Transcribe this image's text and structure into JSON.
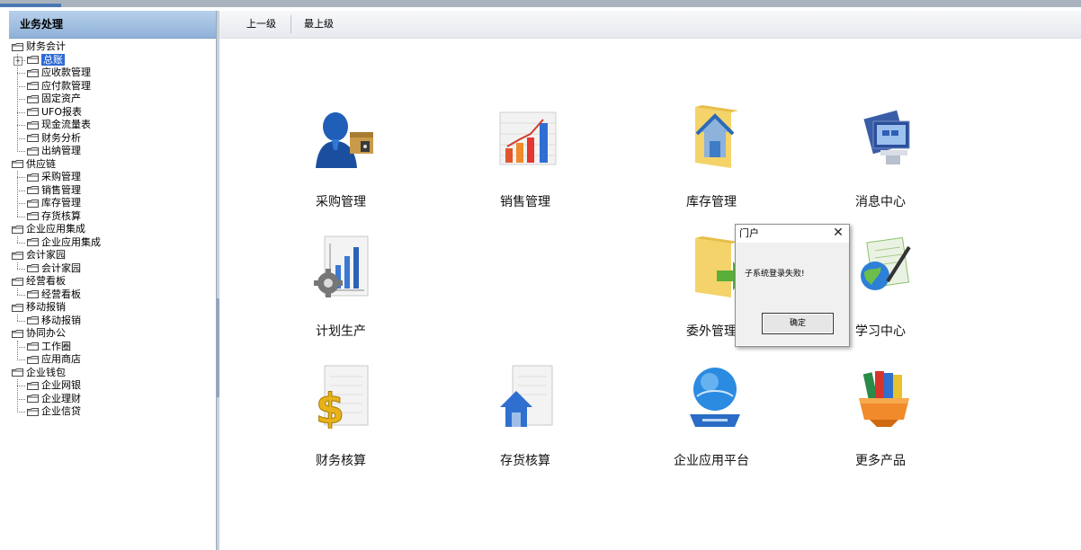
{
  "left_panel": {
    "header": "业务处理",
    "tree": [
      {
        "label": "财务会计",
        "level": 0,
        "expanded": true
      },
      {
        "label": "总账",
        "level": 1,
        "selected": true,
        "collapsed": true
      },
      {
        "label": "应收款管理",
        "level": 1
      },
      {
        "label": "应付款管理",
        "level": 1
      },
      {
        "label": "固定资产",
        "level": 1
      },
      {
        "label": "UFO报表",
        "level": 1
      },
      {
        "label": "现金流量表",
        "level": 1
      },
      {
        "label": "财务分析",
        "level": 1
      },
      {
        "label": "出纳管理",
        "level": 1
      },
      {
        "label": "供应链",
        "level": 0,
        "expanded": true
      },
      {
        "label": "采购管理",
        "level": 1
      },
      {
        "label": "销售管理",
        "level": 1
      },
      {
        "label": "库存管理",
        "level": 1
      },
      {
        "label": "存货核算",
        "level": 1
      },
      {
        "label": "企业应用集成",
        "level": 0,
        "expanded": true
      },
      {
        "label": "企业应用集成",
        "level": 1
      },
      {
        "label": "会计家园",
        "level": 0,
        "expanded": true
      },
      {
        "label": "会计家园",
        "level": 1
      },
      {
        "label": "经营看板",
        "level": 0,
        "expanded": true
      },
      {
        "label": "经营看板",
        "level": 1
      },
      {
        "label": "移动报销",
        "level": 0,
        "expanded": true
      },
      {
        "label": "移动报销",
        "level": 1
      },
      {
        "label": "协同办公",
        "level": 0,
        "expanded": true
      },
      {
        "label": "工作圈",
        "level": 1
      },
      {
        "label": "应用商店",
        "level": 1
      },
      {
        "label": "企业钱包",
        "level": 0,
        "expanded": true
      },
      {
        "label": "企业网银",
        "level": 1
      },
      {
        "label": "企业理财",
        "level": 1
      },
      {
        "label": "企业信贷",
        "level": 1
      }
    ]
  },
  "nav": {
    "up_one": "上一级",
    "top_level": "最上级"
  },
  "apps": [
    {
      "label": "采购管理",
      "icon": "purchase-person-box-icon"
    },
    {
      "label": "销售管理",
      "icon": "sales-bar-chart-icon"
    },
    {
      "label": "库存管理",
      "icon": "warehouse-folder-icon"
    },
    {
      "label": "消息中心",
      "icon": "message-monitor-icon"
    },
    {
      "label": "计划生产",
      "icon": "plan-production-chart-gear-icon"
    },
    {
      "label": "委外管理",
      "icon": "outsourcing-folder-arrow-icon"
    },
    {
      "label": "学习中心",
      "icon": "learning-globe-pen-icon"
    },
    {
      "label": "财务核算",
      "icon": "finance-dollar-icon"
    },
    {
      "label": "存货核算",
      "icon": "inventory-house-doc-icon"
    },
    {
      "label": "企业应用平台",
      "icon": "platform-globe-icon"
    },
    {
      "label": "更多产品",
      "icon": "more-products-books-icon"
    }
  ],
  "dialog": {
    "title": "门户",
    "message": "子系统登录失败!",
    "ok": "确定"
  },
  "colors": {
    "selection": "#2d6ad6",
    "header_blue": "#8fb2d9",
    "dialog_bg": "#f0f0f0"
  }
}
